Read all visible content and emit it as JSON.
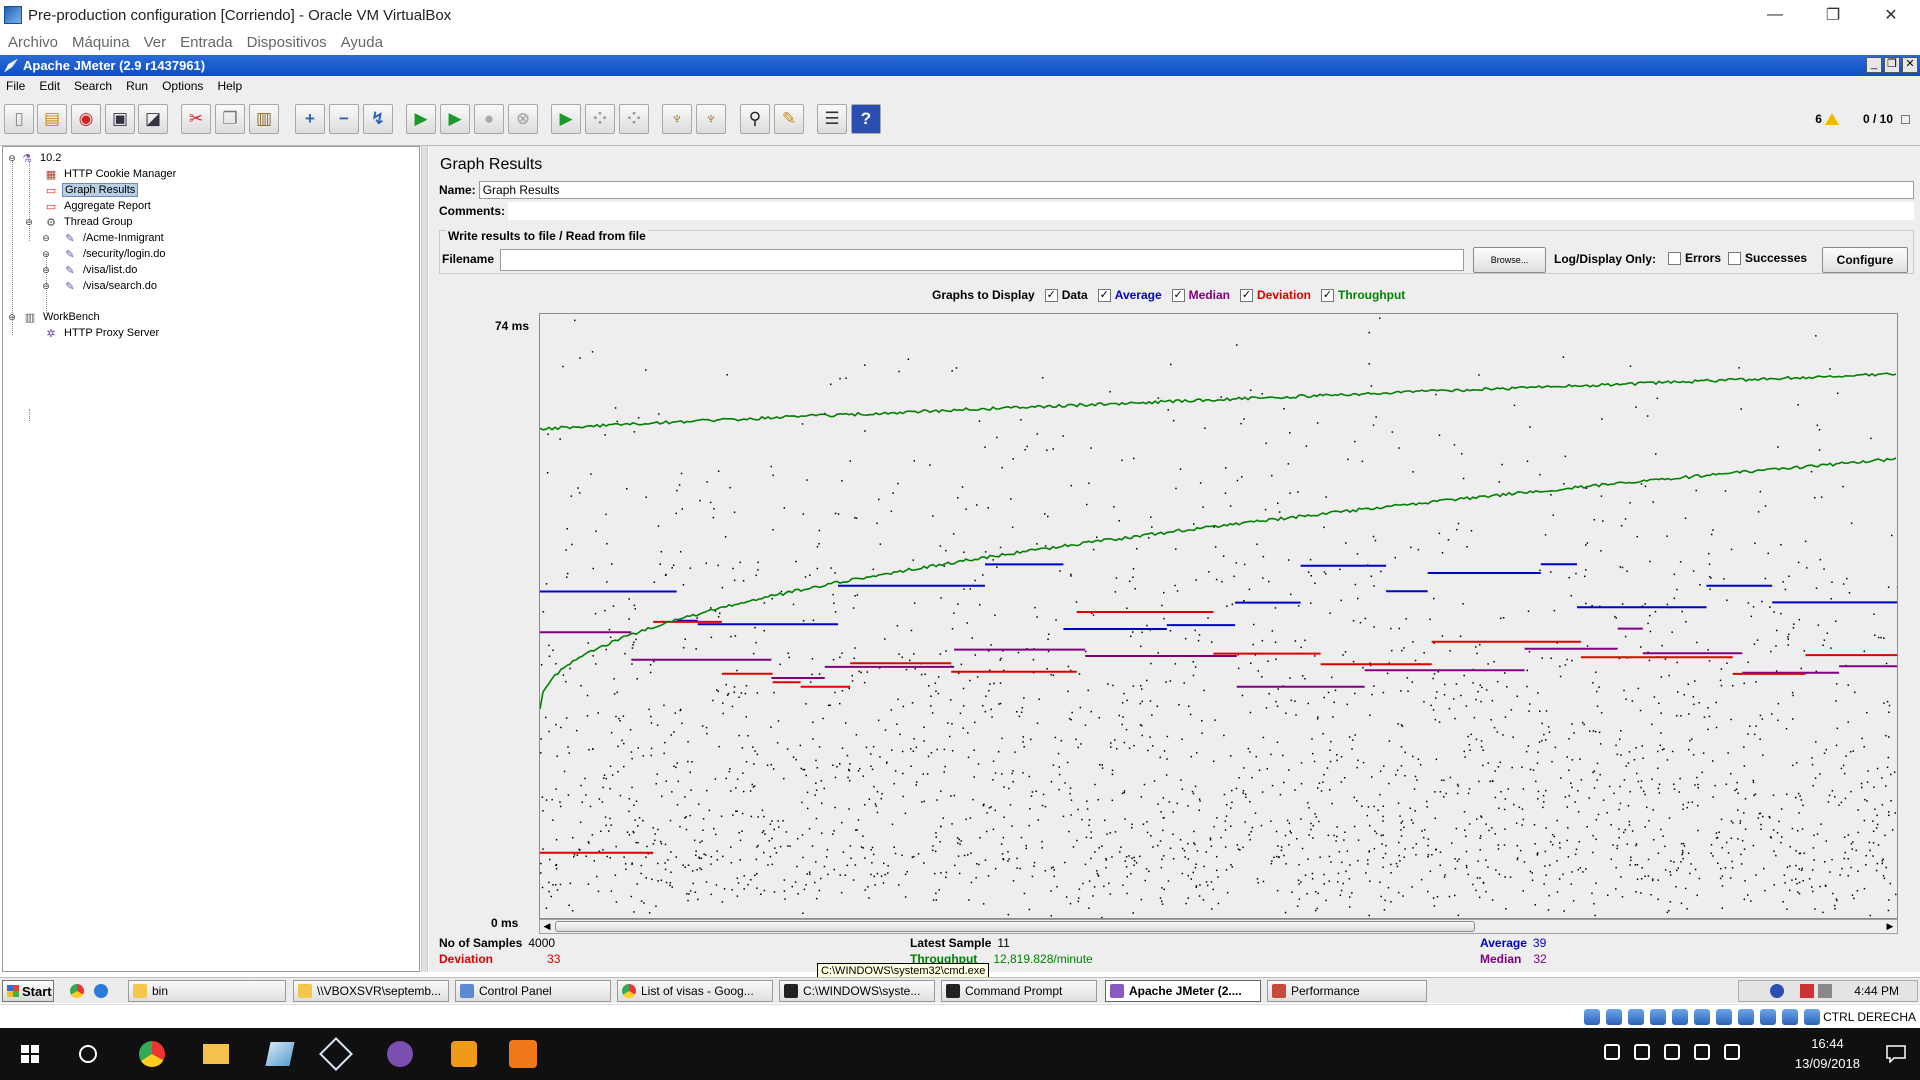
{
  "host_window": {
    "title": "Pre-production configuration [Corriendo] - Oracle VM VirtualBox",
    "menu": [
      "Archivo",
      "Máquina",
      "Ver",
      "Entrada",
      "Dispositivos",
      "Ayuda"
    ],
    "status_hostkey": "CTRL DERECHA"
  },
  "jmeter": {
    "title": "Apache JMeter (2.9 r1437961)",
    "menu": [
      "File",
      "Edit",
      "Search",
      "Run",
      "Options",
      "Help"
    ],
    "toolbar_status": {
      "warnings": "6",
      "threads": "0 / 10"
    }
  },
  "tree": {
    "nodes": [
      {
        "label": "10.2",
        "level": 0,
        "icon": "test-plan-icon"
      },
      {
        "label": "HTTP Cookie Manager",
        "level": 1,
        "icon": "cookie-manager-icon"
      },
      {
        "label": "Graph Results",
        "level": 1,
        "icon": "graph-results-icon",
        "selected": true
      },
      {
        "label": "Aggregate Report",
        "level": 1,
        "icon": "aggregate-report-icon"
      },
      {
        "label": "Thread Group",
        "level": 1,
        "icon": "thread-group-icon"
      },
      {
        "label": "/Acme-Inmigrant",
        "level": 2,
        "icon": "http-sampler-icon"
      },
      {
        "label": "/security/login.do",
        "level": 2,
        "icon": "http-sampler-icon"
      },
      {
        "label": "/visa/list.do",
        "level": 2,
        "icon": "http-sampler-icon"
      },
      {
        "label": "/visa/search.do",
        "level": 2,
        "icon": "http-sampler-icon"
      },
      {
        "label": "WorkBench",
        "level": 0,
        "icon": "workbench-icon"
      },
      {
        "label": "HTTP Proxy Server",
        "level": 1,
        "icon": "proxy-server-icon"
      }
    ]
  },
  "panel": {
    "title": "Graph Results",
    "name_label": "Name:",
    "name_value": "Graph Results",
    "comments_label": "Comments:",
    "file_group_legend": "Write results to file / Read from file",
    "filename_label": "Filename",
    "browse_label": "Browse...",
    "log_display_label": "Log/Display Only:",
    "errors_label": "Errors",
    "successes_label": "Successes",
    "configure_label": "Configure",
    "graphs_to_display_label": "Graphs to Display",
    "graph_options": [
      {
        "label": "Data",
        "checked": true,
        "color": "#000000"
      },
      {
        "label": "Average",
        "checked": true,
        "color": "#0000cc"
      },
      {
        "label": "Median",
        "checked": true,
        "color": "#800080"
      },
      {
        "label": "Deviation",
        "checked": true,
        "color": "#dd0000"
      },
      {
        "label": "Throughput",
        "checked": true,
        "color": "#008000"
      }
    ],
    "y_max_label": "74  ms",
    "y_min_label": "0  ms"
  },
  "stats": {
    "samples_label": "No of Samples",
    "samples_value": "4000",
    "latest_label": "Latest Sample",
    "latest_value": "11",
    "average_label": "Average",
    "average_value": "39",
    "deviation_label": "Deviation",
    "deviation_value": "33",
    "throughput_label": "Throughput",
    "throughput_value": "12,819.828/minute",
    "median_label": "Median",
    "median_value": "32"
  },
  "guest_taskbar": {
    "start_label": "Start",
    "buttons": [
      "bin",
      "\\\\VBOXSVR\\septemb...",
      "Control Panel",
      "List of visas - Goog...",
      "C:\\WINDOWS\\syste...",
      "Command Prompt",
      "Apache JMeter (2....",
      "Performance"
    ],
    "active": "Apache JMeter (2....",
    "clock": "4:44 PM",
    "tooltip": "C:\\WINDOWS\\system32\\cmd.exe"
  },
  "host_taskbar": {
    "time": "16:44",
    "date": "13/09/2018"
  },
  "chart_data": {
    "type": "scatter",
    "title": "",
    "xlabel": "",
    "ylabel": "",
    "ylim": [
      0,
      74
    ],
    "y_unit": "ms",
    "samples": 4000,
    "series": [
      {
        "name": "Data",
        "color": "#000000",
        "kind": "points"
      },
      {
        "name": "Average",
        "color": "#0000cc",
        "start": 40,
        "end": 39
      },
      {
        "name": "Median",
        "color": "#800080",
        "start": 35,
        "end": 32
      },
      {
        "name": "Deviation",
        "color": "#dd0000",
        "start": 8,
        "end": 33
      },
      {
        "name": "Throughput",
        "color": "#008000",
        "kind": "line"
      }
    ],
    "summary": {
      "average": 39,
      "median": 32,
      "deviation": 33,
      "latest": 11,
      "throughput": "12,819.828/minute"
    }
  }
}
